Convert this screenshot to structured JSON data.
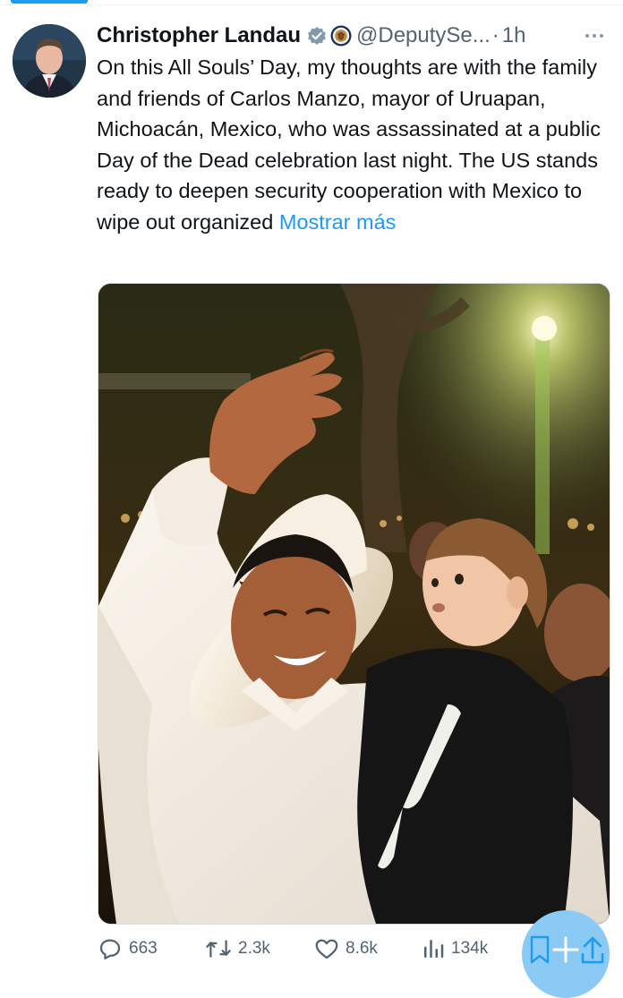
{
  "tweet": {
    "author": {
      "display_name": "Christopher Landau",
      "handle": "@DeputySe...",
      "verified_badge_icon": "verified-gray-badge-icon",
      "affiliation_icon": "state-department-seal-icon"
    },
    "separator": "·",
    "time": "1h",
    "more_icon": "more-options-icon",
    "text": "On this All Souls’ Day, my thoughts are with the family and friends of Carlos Manzo, mayor of Uruapan, Michoacán, Mexico, who was assassinated at a public Day of the Dead celebration last night. The US stands ready to deepen security cooperation with Mexico to wipe out organized ",
    "show_more": "Mostrar más"
  },
  "actions": {
    "reply": {
      "icon": "reply-icon",
      "count": "663"
    },
    "retweet": {
      "icon": "retweet-icon",
      "count": "2.3k"
    },
    "like": {
      "icon": "like-icon",
      "count": "8.6k"
    },
    "views": {
      "icon": "views-icon",
      "count": "134k"
    },
    "bookmark": {
      "icon": "bookmark-icon"
    },
    "share": {
      "icon": "share-icon"
    }
  },
  "colors": {
    "accent": "#1d9bf0",
    "text": "#0f1419",
    "secondary": "#536471"
  }
}
